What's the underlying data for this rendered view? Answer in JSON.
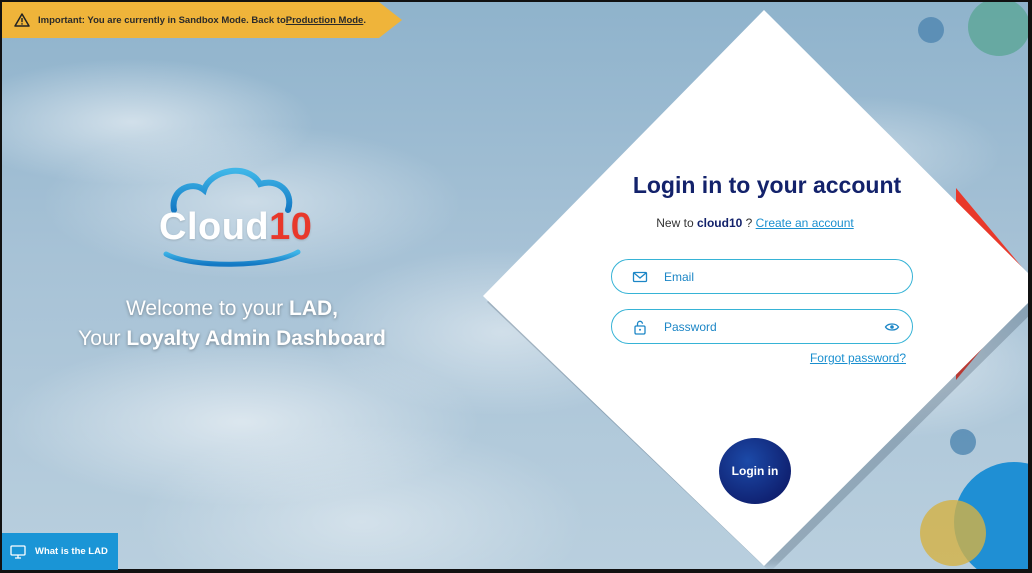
{
  "banner": {
    "prefix": "Important: You are currently in Sandbox Mode. Back to ",
    "link": "Production Mode",
    "suffix": "."
  },
  "brand": {
    "name_main": "Cloud",
    "name_num": "10",
    "colors": {
      "accent_red": "#e8382b",
      "navy": "#13226b",
      "link_blue": "#1a8fcf",
      "banner": "#efb43a"
    }
  },
  "welcome": {
    "line1_prefix": "Welcome to your ",
    "line1_bold": "LAD,",
    "line2_prefix": "Your ",
    "line2_bold": "Loyalty Admin Dashboard"
  },
  "login": {
    "title": "Login in to your account",
    "new_prefix": "New to ",
    "new_brand": "cloud10",
    "new_sep": " ? ",
    "create_link": "Create an account",
    "email_placeholder": "Email",
    "password_placeholder": "Password",
    "forgot": "Forgot password?",
    "submit": "Login in"
  },
  "help": {
    "what_is_lad": "What is the LAD"
  }
}
